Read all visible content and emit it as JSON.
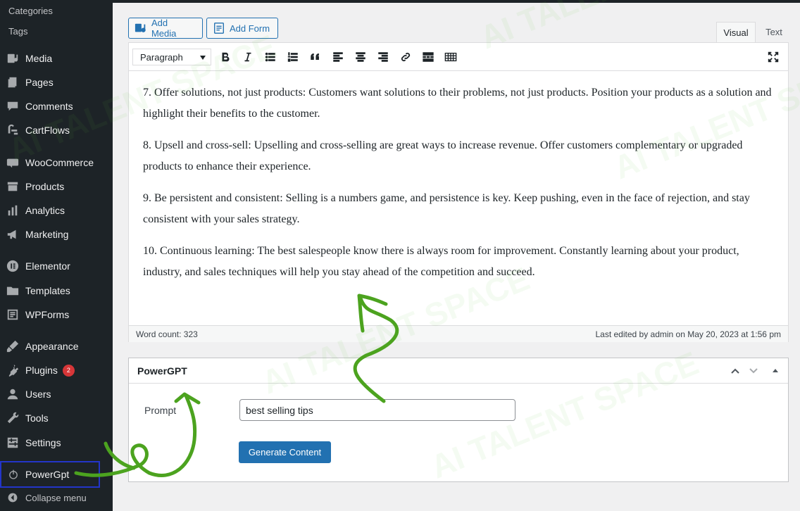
{
  "sidebar": {
    "sub_items": [
      "Categories",
      "Tags"
    ],
    "items": [
      {
        "label": "Media",
        "icon": "media-icon"
      },
      {
        "label": "Pages",
        "icon": "pages-icon"
      },
      {
        "label": "Comments",
        "icon": "comments-icon"
      },
      {
        "label": "CartFlows",
        "icon": "cartflows-icon"
      },
      {
        "label": "WooCommerce",
        "icon": "woocommerce-icon"
      },
      {
        "label": "Products",
        "icon": "products-icon"
      },
      {
        "label": "Analytics",
        "icon": "analytics-icon"
      },
      {
        "label": "Marketing",
        "icon": "marketing-icon"
      },
      {
        "label": "Elementor",
        "icon": "elementor-icon"
      },
      {
        "label": "Templates",
        "icon": "templates-icon"
      },
      {
        "label": "WPForms",
        "icon": "wpforms-icon"
      },
      {
        "label": "Appearance",
        "icon": "appearance-icon"
      },
      {
        "label": "Plugins",
        "icon": "plugins-icon",
        "badge": "2"
      },
      {
        "label": "Users",
        "icon": "users-icon"
      },
      {
        "label": "Tools",
        "icon": "tools-icon"
      },
      {
        "label": "Settings",
        "icon": "settings-icon"
      }
    ],
    "powergpt": {
      "label": "PowerGpt",
      "icon": "power-icon"
    },
    "collapse": {
      "label": "Collapse menu",
      "icon": "collapse-icon"
    }
  },
  "editor": {
    "add_media": "Add Media",
    "add_form": "Add Form",
    "tab_visual": "Visual",
    "tab_text": "Text",
    "format": "Paragraph",
    "paragraphs": [
      "7. Offer solutions, not just products: Customers want solutions to their problems, not just products. Position your products as a solution and highlight their benefits to the customer.",
      "8. Upsell and cross-sell: Upselling and cross-selling are great ways to increase revenue. Offer customers complementary or upgraded products to enhance their experience.",
      "9. Be persistent and consistent: Selling is a numbers game, and persistence is key. Keep pushing, even in the face of rejection, and stay consistent with your sales strategy.",
      "10. Continuous learning: The best salespeople know there is always room for improvement. Constantly learning about your product, industry, and sales techniques will help you stay ahead of the competition and succeed."
    ],
    "word_count": "Word count: 323",
    "last_edited": "Last edited by admin on May 20, 2023 at 1:56 pm"
  },
  "powergpt_box": {
    "title": "PowerGPT",
    "prompt_label": "Prompt",
    "prompt_value": "best selling tips",
    "generate_label": "Generate Content"
  },
  "watermark": "AI TALENT SPACE",
  "colors": {
    "sidebar_bg": "#1d2327",
    "accent": "#2271b1",
    "arrow": "#4ca31f",
    "highlight_border": "#2335c9",
    "badge": "#d63638"
  }
}
